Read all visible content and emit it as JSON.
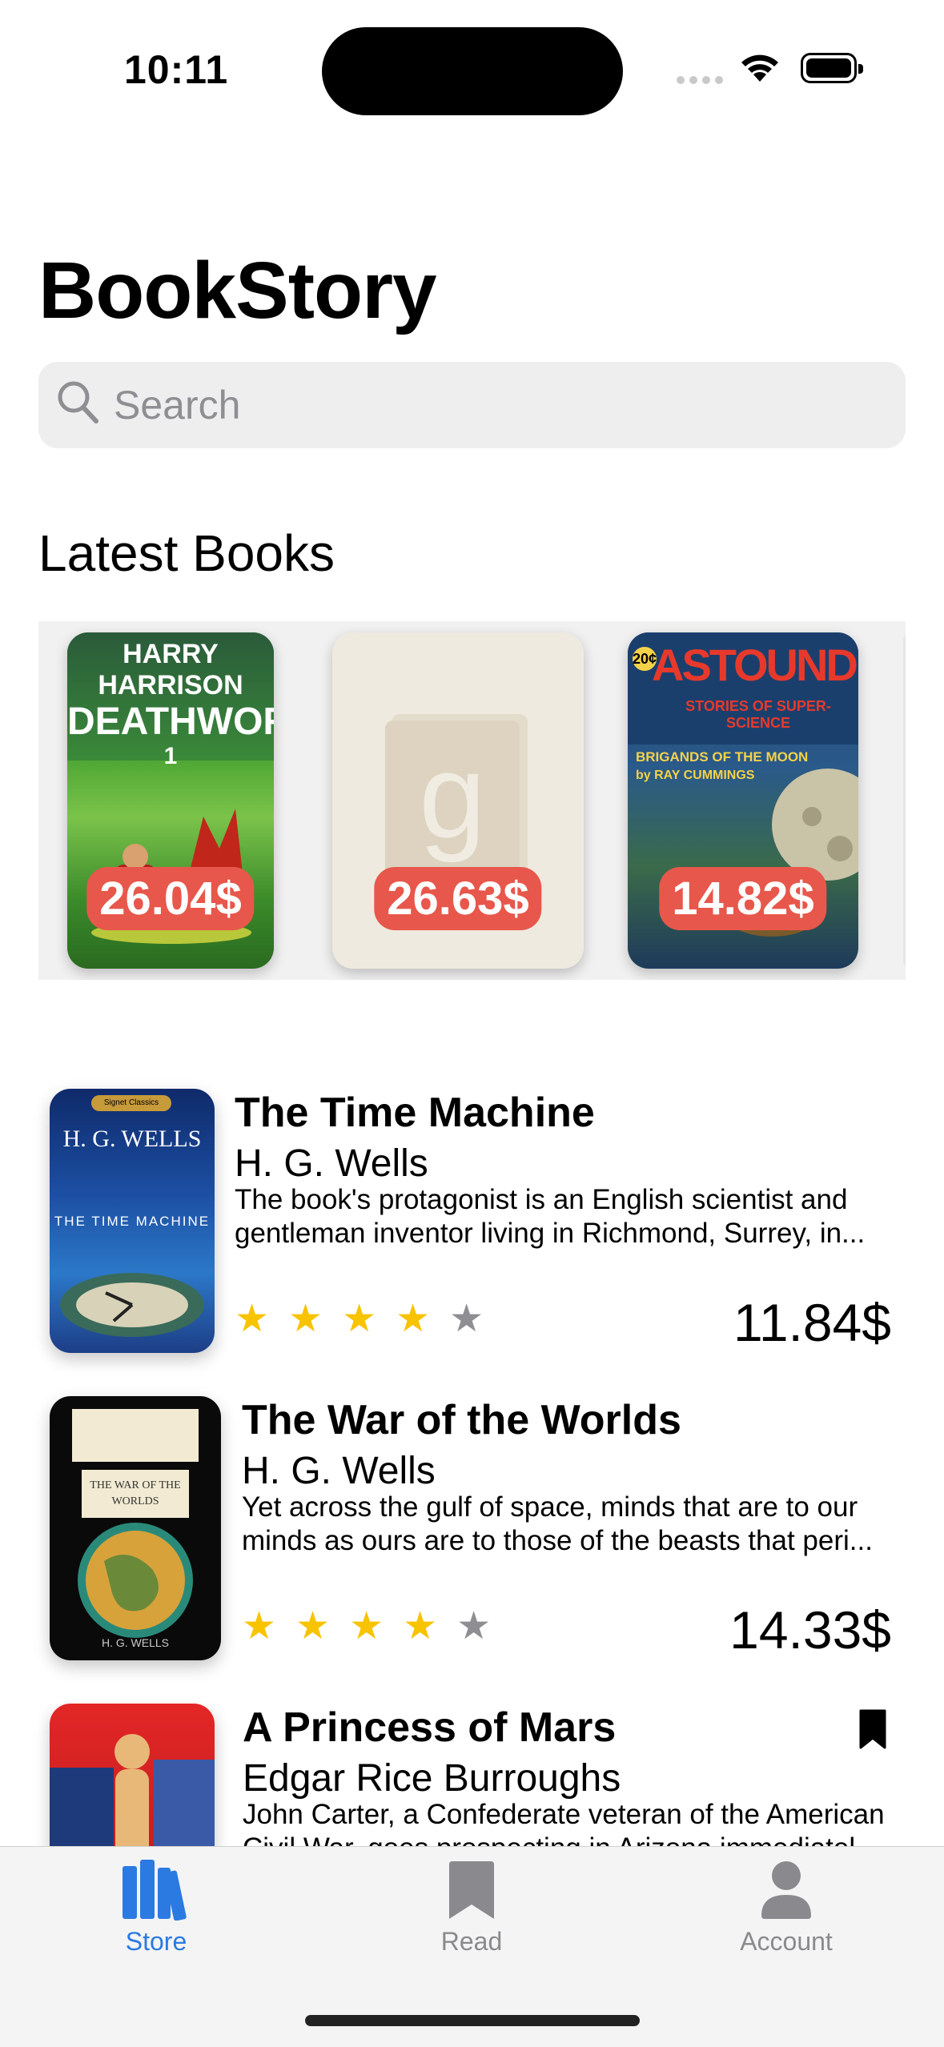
{
  "status_bar": {
    "time": "10:11"
  },
  "app": {
    "title": "BookStory"
  },
  "search": {
    "placeholder": "Search",
    "value": ""
  },
  "latest": {
    "title": "Latest Books",
    "items": [
      {
        "price": "26.04$",
        "cover_author": "HARRY HARRISON",
        "cover_title": "DEATHWORLD",
        "cover_number": "1"
      },
      {
        "price": "26.63$",
        "placeholder_glyph": "g"
      },
      {
        "price": "14.82$",
        "cover_title": "ASTOUNDING",
        "cover_subtitle": "STORIES OF SUPER-SCIENCE",
        "cover_price": "20¢",
        "cover_feature": "BRIGANDS OF THE MOON",
        "cover_byline": "by RAY CUMMINGS"
      }
    ]
  },
  "books": [
    {
      "title": "The Time Machine",
      "author": "H. G. Wells",
      "description_lines": [
        "The book's protagonist is an English scientist and",
        "gentleman inventor living in Richmond, Surrey, in..."
      ],
      "rating": 4,
      "price": "11.84$",
      "bookmarked": false,
      "cover": {
        "series": "Signet Classics",
        "author": "H. G. WELLS",
        "title": "THE TIME MACHINE"
      }
    },
    {
      "title": "The War of the Worlds",
      "author": "H. G. Wells",
      "description_lines": [
        "Yet across the gulf of space, minds that are to our",
        "minds as ours are to those of the beasts that peri..."
      ],
      "rating": 4,
      "price": "14.33$",
      "bookmarked": false,
      "cover": {
        "title": "THE WAR OF THE WORLDS",
        "author": "H. G. WELLS"
      }
    },
    {
      "title": "A Princess of Mars",
      "author": "Edgar Rice Burroughs",
      "description_lines": [
        "John Carter, a Confederate veteran of the American",
        "Civil War, goes prospecting in Arizona immediatel..."
      ],
      "rating": null,
      "price": "",
      "bookmarked": true
    }
  ],
  "tabs": [
    {
      "label": "Store",
      "icon": "books-icon",
      "active": true
    },
    {
      "label": "Read",
      "icon": "bookmark-icon",
      "active": false
    },
    {
      "label": "Account",
      "icon": "person-icon",
      "active": false
    }
  ],
  "colors": {
    "accent": "#2a7ae2",
    "price_badge": "#e8574b",
    "star": "#f8c300"
  }
}
